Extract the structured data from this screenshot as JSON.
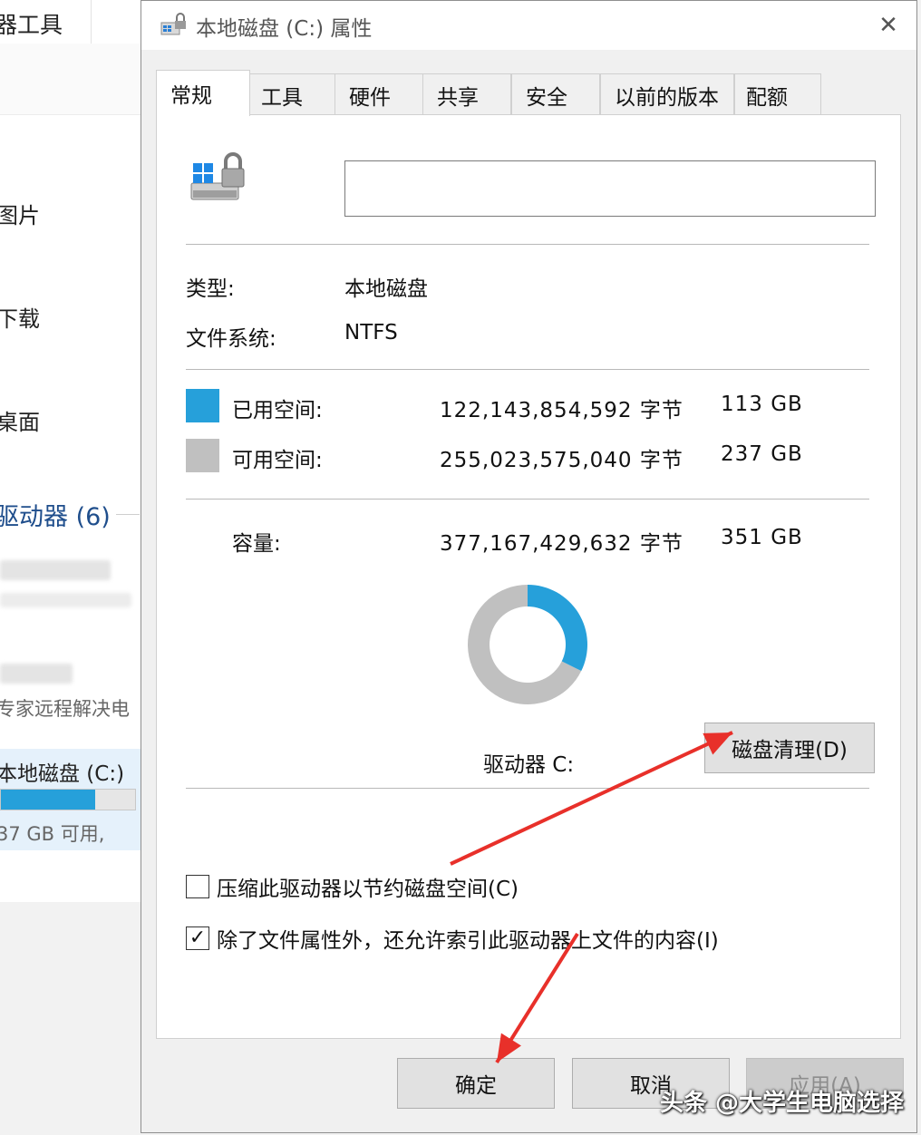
{
  "colors": {
    "used": "#26a0da",
    "free": "#c0c0c0",
    "annotation_arrow": "#e8302a"
  },
  "background_window": {
    "ribbon_label": "器工具",
    "nav_items": [
      "图片",
      "下载",
      "桌面"
    ],
    "section_label": "驱动器 (6)",
    "sub_label": "专家远程解决电",
    "drive_title": "本地磁盘 (C:)",
    "drive_used_fraction": 0.7,
    "drive_free": "37 GB 可用,"
  },
  "dialog": {
    "title": "本地磁盘 (C:) 属性",
    "close_icon": "close-icon",
    "tabs": [
      {
        "label": "常规",
        "active": true
      },
      {
        "label": "工具",
        "active": false
      },
      {
        "label": "硬件",
        "active": false
      },
      {
        "label": "共享",
        "active": false
      },
      {
        "label": "安全",
        "active": false
      },
      {
        "label": "以前的版本",
        "active": false
      },
      {
        "label": "配额",
        "active": false
      }
    ],
    "volume_label_value": "",
    "type_label": "类型:",
    "type_value": "本地磁盘",
    "fs_label": "文件系统:",
    "fs_value": "NTFS",
    "used_label": "已用空间:",
    "used_bytes": "122,143,854,592 字节",
    "used_gb": "113 GB",
    "free_label": "可用空间:",
    "free_bytes": "255,023,575,040 字节",
    "free_gb": "237 GB",
    "capacity_label": "容量:",
    "capacity_bytes": "377,167,429,632 字节",
    "capacity_gb": "351 GB",
    "drive_label": "驱动器 C:",
    "cleanup_button": "磁盘清理(D)",
    "compress_label": "压缩此驱动器以节约磁盘空间(C)",
    "compress_checked": false,
    "index_label": "除了文件属性外，还允许索引此驱动器上文件的内容(I)",
    "index_checked": true,
    "ok_button": "确定",
    "cancel_button": "取消",
    "apply_button": "应用(A)"
  },
  "chart_data": {
    "type": "pie",
    "categories": [
      "已用空间",
      "可用空间"
    ],
    "values": [
      113,
      237
    ],
    "units": "GB"
  },
  "watermark": "头条 @大学生电脑选择"
}
